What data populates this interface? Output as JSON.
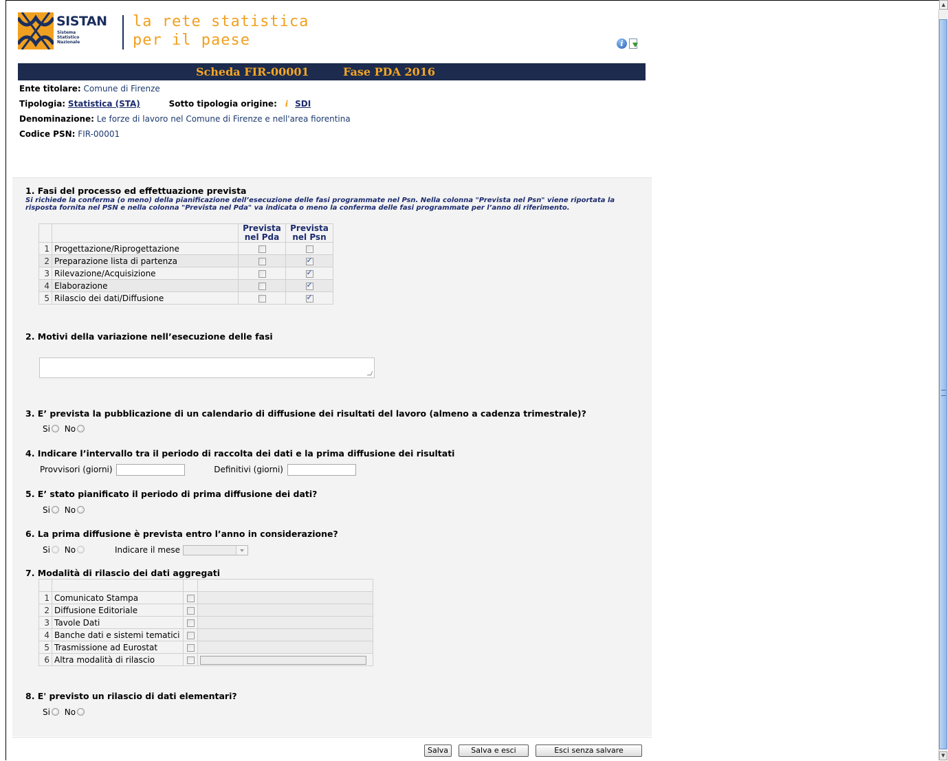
{
  "brand": {
    "name": "SISTAN",
    "subtitle_line1": "Sistema Statistico",
    "subtitle_line2": "Nazionale",
    "tagline_line1": "la rete statistica",
    "tagline_line2": "per il paese"
  },
  "toolbar_icons": [
    "help-icon",
    "export-icon"
  ],
  "title_bar": {
    "scheda": "Scheda FIR-00001",
    "fase": "Fase PDA 2016"
  },
  "header": {
    "ente_label": "Ente titolare:",
    "ente_value": "Comune di Firenze",
    "tipologia_label": "Tipologia:",
    "tipologia_value": "Statistica (STA)",
    "sotto_label": "Sotto tipologia origine:",
    "sotto_info": "i",
    "sotto_value": "SDI",
    "denominazione_label": "Denominazione:",
    "denominazione_value": "Le forze di lavoro nel Comune di Firenze e nell'area fiorentina",
    "codice_label": "Codice PSN:",
    "codice_value": "FIR-00001"
  },
  "section1": {
    "title": "1. Fasi del processo ed effettuazione prevista",
    "note": "Si richiede la conferma (o meno) della pianificazione dell’esecuzione delle fasi programmate nel Psn. Nella colonna \"Prevista nel Psn\" viene riportata la risposta fornita nel PSN e nella colonna \"Prevista nel Pda\" va indicata o meno la conferma delle fasi programmate per l’anno di riferimento.",
    "col_pda_line1": "Prevista",
    "col_pda_line2": "nel Pda",
    "col_psn_line1": "Prevista",
    "col_psn_line2": "nel Psn",
    "rows": [
      {
        "n": "1",
        "label": "Progettazione/Riprogettazione",
        "pda": false,
        "psn": false
      },
      {
        "n": "2",
        "label": "Preparazione lista di partenza",
        "pda": false,
        "psn": true
      },
      {
        "n": "3",
        "label": "Rilevazione/Acquisizione",
        "pda": false,
        "psn": true
      },
      {
        "n": "4",
        "label": "Elaborazione",
        "pda": false,
        "psn": true
      },
      {
        "n": "5",
        "label": "Rilascio dei dati/Diffusione",
        "pda": false,
        "psn": true
      }
    ]
  },
  "section2": {
    "title": "2. Motivi della variazione nell’esecuzione delle fasi",
    "value": ""
  },
  "section3": {
    "title": "3. E’ prevista la pubblicazione di un calendario di diffusione dei risultati del lavoro (almeno a cadenza  trimestrale)?",
    "si": "Si",
    "no": "No"
  },
  "section4": {
    "title": "4. Indicare l’intervallo tra il periodo di raccolta dei dati e la prima diffusione dei risultati",
    "provvisori_label": "Provvisori (giorni)",
    "provvisori_value": "",
    "definitivi_label": "Definitivi (giorni)",
    "definitivi_value": ""
  },
  "section5": {
    "title": "5. E’ stato pianificato il periodo di prima diffusione dei dati?",
    "si": "Si",
    "no": "No"
  },
  "section6": {
    "title": "6. La prima diffusione è prevista entro l’anno in considerazione?",
    "si": "Si",
    "no": "No",
    "mese_label": "Indicare il mese",
    "mese_value": ""
  },
  "section7": {
    "title": "7. Modalità di rilascio dei dati aggregati",
    "rows": [
      {
        "n": "1",
        "label": "Comunicato Stampa",
        "checked": false
      },
      {
        "n": "2",
        "label": "Diffusione Editoriale",
        "checked": false
      },
      {
        "n": "3",
        "label": "Tavole Dati",
        "checked": false
      },
      {
        "n": "4",
        "label": "Banche dati e sistemi tematici",
        "checked": false
      },
      {
        "n": "5",
        "label": "Trasmissione ad Eurostat",
        "checked": false
      },
      {
        "n": "6",
        "label": "Altra modalità di rilascio",
        "checked": false
      }
    ]
  },
  "section8": {
    "title": "8. E' previsto un rilascio di dati elementari?",
    "si": "Si",
    "no": "No"
  },
  "buttons": {
    "salva": "Salva",
    "salva_esci": "Salva e esci",
    "esci": "Esci senza salvare"
  },
  "colors": {
    "title_bar_bg": "#1c2b4e",
    "title_bar_text": "#f5a623",
    "brand_navy": "#1b2f5e",
    "tagline_orange": "#f0a020"
  }
}
